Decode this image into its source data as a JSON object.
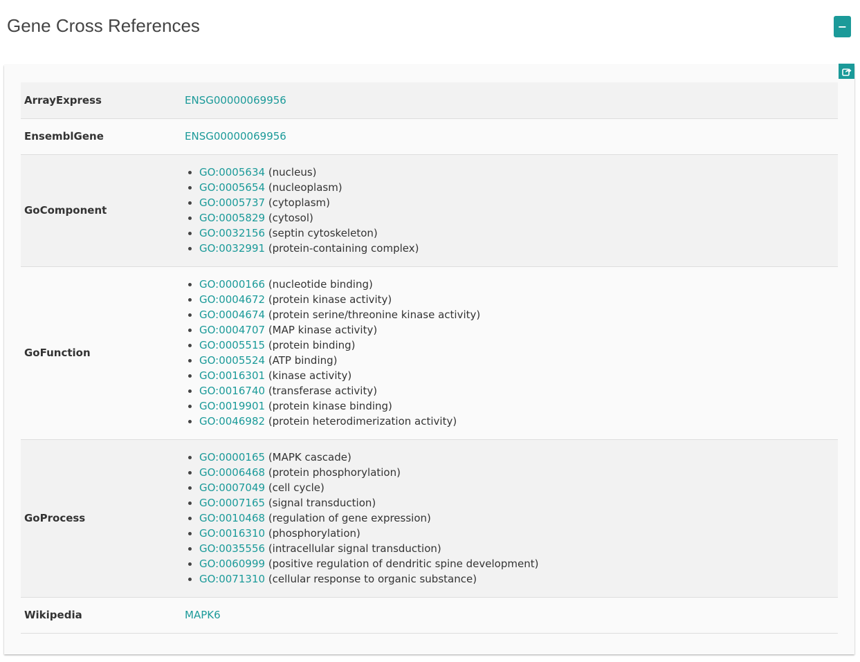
{
  "header": {
    "title": "Gene Cross References",
    "collapse_label": "−"
  },
  "colors": {
    "accent": "#1b9a99",
    "text": "#333333"
  },
  "icons": {
    "share": "share-icon"
  },
  "rows": [
    {
      "label": "ArrayExpress",
      "link": "ENSG00000069956"
    },
    {
      "label": "EnsemblGene",
      "link": "ENSG00000069956"
    },
    {
      "label": "GoComponent",
      "items": [
        {
          "id": "GO:0005634",
          "desc": "(nucleus)"
        },
        {
          "id": "GO:0005654",
          "desc": "(nucleoplasm)"
        },
        {
          "id": "GO:0005737",
          "desc": "(cytoplasm)"
        },
        {
          "id": "GO:0005829",
          "desc": "(cytosol)"
        },
        {
          "id": "GO:0032156",
          "desc": "(septin cytoskeleton)"
        },
        {
          "id": "GO:0032991",
          "desc": "(protein-containing complex)"
        }
      ]
    },
    {
      "label": "GoFunction",
      "items": [
        {
          "id": "GO:0000166",
          "desc": "(nucleotide binding)"
        },
        {
          "id": "GO:0004672",
          "desc": "(protein kinase activity)"
        },
        {
          "id": "GO:0004674",
          "desc": "(protein serine/threonine kinase activity)"
        },
        {
          "id": "GO:0004707",
          "desc": "(MAP kinase activity)"
        },
        {
          "id": "GO:0005515",
          "desc": "(protein binding)"
        },
        {
          "id": "GO:0005524",
          "desc": "(ATP binding)"
        },
        {
          "id": "GO:0016301",
          "desc": "(kinase activity)"
        },
        {
          "id": "GO:0016740",
          "desc": "(transferase activity)"
        },
        {
          "id": "GO:0019901",
          "desc": "(protein kinase binding)"
        },
        {
          "id": "GO:0046982",
          "desc": "(protein heterodimerization activity)"
        }
      ]
    },
    {
      "label": "GoProcess",
      "items": [
        {
          "id": "GO:0000165",
          "desc": "(MAPK cascade)"
        },
        {
          "id": "GO:0006468",
          "desc": "(protein phosphorylation)"
        },
        {
          "id": "GO:0007049",
          "desc": "(cell cycle)"
        },
        {
          "id": "GO:0007165",
          "desc": "(signal transduction)"
        },
        {
          "id": "GO:0010468",
          "desc": "(regulation of gene expression)"
        },
        {
          "id": "GO:0016310",
          "desc": "(phosphorylation)"
        },
        {
          "id": "GO:0035556",
          "desc": "(intracellular signal transduction)"
        },
        {
          "id": "GO:0060999",
          "desc": "(positive regulation of dendritic spine development)"
        },
        {
          "id": "GO:0071310",
          "desc": "(cellular response to organic substance)"
        }
      ]
    },
    {
      "label": "Wikipedia",
      "link": "MAPK6"
    }
  ]
}
